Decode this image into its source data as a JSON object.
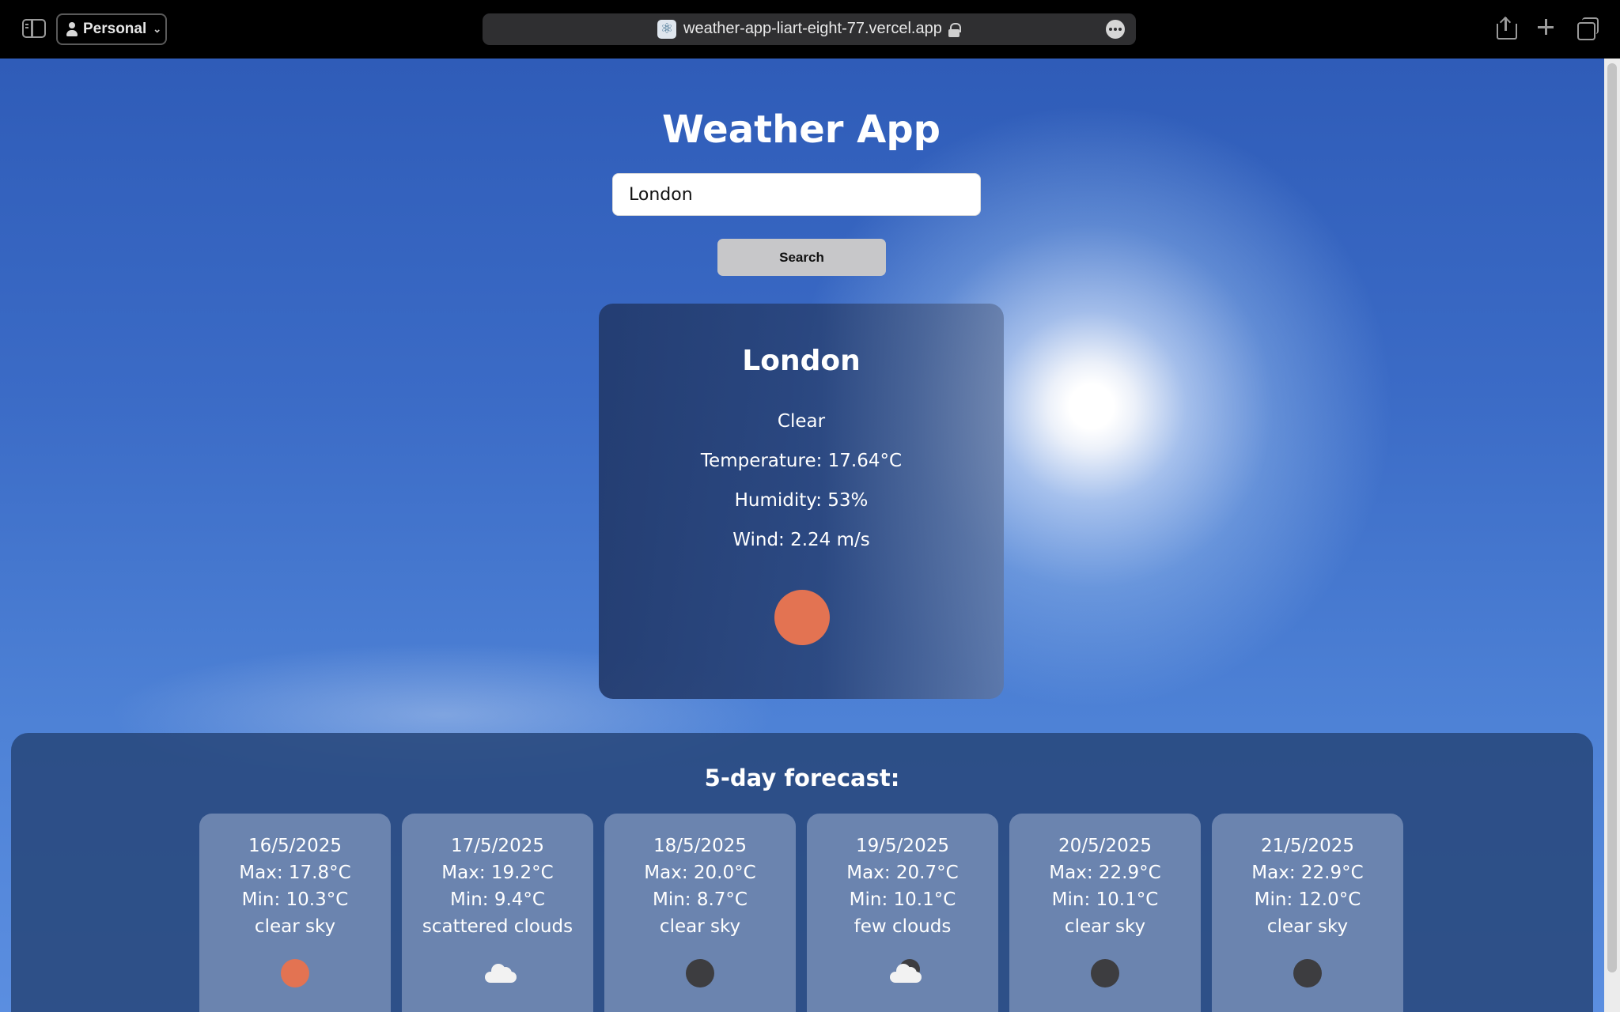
{
  "browser": {
    "profile_label": "Personal",
    "url": "weather-app-liart-eight-77.vercel.app"
  },
  "app": {
    "title": "Weather App",
    "search": {
      "value": "London",
      "button_label": "Search"
    }
  },
  "current": {
    "city": "London",
    "condition": "Clear",
    "temperature": "Temperature: 17.64°C",
    "humidity": "Humidity: 53%",
    "wind": "Wind: 2.24 m/s",
    "icon": "sun-icon"
  },
  "forecast": {
    "title": "5-day forecast:",
    "days": [
      {
        "date": "16/5/2025",
        "max": "Max: 17.8°C",
        "min": "Min: 10.3°C",
        "desc": "clear sky",
        "icon": "sun-icon"
      },
      {
        "date": "17/5/2025",
        "max": "Max: 19.2°C",
        "min": "Min: 9.4°C",
        "desc": "scattered clouds",
        "icon": "cloud-icon"
      },
      {
        "date": "18/5/2025",
        "max": "Max: 20.0°C",
        "min": "Min: 8.7°C",
        "desc": "clear sky",
        "icon": "moon-icon"
      },
      {
        "date": "19/5/2025",
        "max": "Max: 20.7°C",
        "min": "Min: 10.1°C",
        "desc": "few clouds",
        "icon": "few-clouds-night-icon"
      },
      {
        "date": "20/5/2025",
        "max": "Max: 22.9°C",
        "min": "Min: 10.1°C",
        "desc": "clear sky",
        "icon": "moon-icon"
      },
      {
        "date": "21/5/2025",
        "max": "Max: 22.9°C",
        "min": "Min: 12.0°C",
        "desc": "clear sky",
        "icon": "moon-icon"
      }
    ]
  },
  "colors": {
    "sun": "#e37352",
    "moon": "#3d3d40",
    "card_bg": "#2b4578",
    "search_button": "#c7c7c9"
  }
}
